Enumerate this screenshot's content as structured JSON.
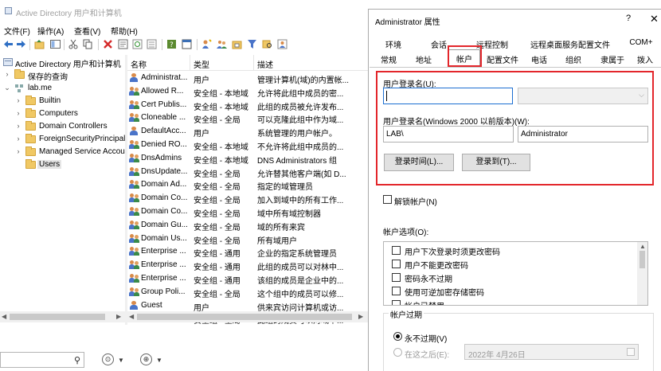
{
  "main_window": {
    "title": "Active Directory 用户和计算机"
  },
  "menu": [
    "文件(F)",
    "操作(A)",
    "查看(V)",
    "帮助(H)"
  ],
  "tree": {
    "root": "Active Directory 用户和计算机",
    "saved_queries": "保存的查询",
    "domain": "lab.me",
    "containers": [
      "Builtin",
      "Computers",
      "Domain Controllers",
      "ForeignSecurityPrincipals",
      "Managed Service Accounts",
      "Users"
    ]
  },
  "list": {
    "columns": [
      "名称",
      "类型",
      "描述"
    ],
    "rows": [
      {
        "name": "Administrat...",
        "type": "用户",
        "desc": "管理计算机(域)的内置帐...",
        "icon": "user-icon"
      },
      {
        "name": "Allowed R...",
        "type": "安全组 - 本地域",
        "desc": "允许将此组中成员的密...",
        "icon": "group-icon"
      },
      {
        "name": "Cert Publis...",
        "type": "安全组 - 本地域",
        "desc": "此组的成员被允许发布...",
        "icon": "group-icon"
      },
      {
        "name": "Cloneable ...",
        "type": "安全组 - 全局",
        "desc": "可以克隆此组中作为域...",
        "icon": "group-icon"
      },
      {
        "name": "DefaultAcc...",
        "type": "用户",
        "desc": "系统管理的用户帐户。",
        "icon": "user-icon"
      },
      {
        "name": "Denied RO...",
        "type": "安全组 - 本地域",
        "desc": "不允许将此组中成员的...",
        "icon": "group-icon"
      },
      {
        "name": "DnsAdmins",
        "type": "安全组 - 本地域",
        "desc": "DNS Administrators 组",
        "icon": "group-icon"
      },
      {
        "name": "DnsUpdate...",
        "type": "安全组 - 全局",
        "desc": "允许替其他客户端(如 D...",
        "icon": "group-icon"
      },
      {
        "name": "Domain Ad...",
        "type": "安全组 - 全局",
        "desc": "指定的域管理员",
        "icon": "group-icon"
      },
      {
        "name": "Domain Co...",
        "type": "安全组 - 全局",
        "desc": "加入到域中的所有工作...",
        "icon": "group-icon"
      },
      {
        "name": "Domain Co...",
        "type": "安全组 - 全局",
        "desc": "域中所有域控制器",
        "icon": "group-icon"
      },
      {
        "name": "Domain Gu...",
        "type": "安全组 - 全局",
        "desc": "域的所有来宾",
        "icon": "group-icon"
      },
      {
        "name": "Domain Us...",
        "type": "安全组 - 全局",
        "desc": "所有域用户",
        "icon": "group-icon"
      },
      {
        "name": "Enterprise ...",
        "type": "安全组 - 通用",
        "desc": "企业的指定系统管理员",
        "icon": "group-icon"
      },
      {
        "name": "Enterprise ...",
        "type": "安全组 - 通用",
        "desc": "此组的成员可以对林中...",
        "icon": "group-icon"
      },
      {
        "name": "Enterprise ...",
        "type": "安全组 - 通用",
        "desc": "该组的成员是企业中的...",
        "icon": "group-icon"
      },
      {
        "name": "Group Poli...",
        "type": "安全组 - 全局",
        "desc": "这个组中的成员可以修...",
        "icon": "group-icon"
      },
      {
        "name": "Guest",
        "type": "用户",
        "desc": "供来宾访问计算机或访...",
        "icon": "user-icon"
      },
      {
        "name": "Key Admins",
        "type": "安全组 - 全局",
        "desc": "此组的成员可以对域中...",
        "icon": "group-icon"
      }
    ]
  },
  "dialog": {
    "title": "Administrator 属性",
    "help_glyph": "?",
    "close_glyph": "✕",
    "tabs_row1": [
      "环境",
      "会话",
      "远程控制",
      "远程桌面服务配置文件",
      "COM+"
    ],
    "tabs_row2": [
      "常规",
      "地址",
      "帐户",
      "配置文件",
      "电话",
      "组织",
      "隶属于",
      "拨入"
    ],
    "active_tab": "帐户",
    "logon_name_label": "用户登录名(U):",
    "logon_name_value": "",
    "upn_suffix_value": "",
    "pre2000_label": "用户登录名(Windows 2000 以前版本)(W):",
    "pre2000_domain": "LAB\\",
    "pre2000_name": "Administrator",
    "logon_hours_button": "登录时间(L)...",
    "logon_to_button": "登录到(T)...",
    "unlock_label": "解锁帐户(N)",
    "options_label": "帐户选项(O):",
    "options": [
      "用户下次登录时须更改密码",
      "用户不能更改密码",
      "密码永不过期",
      "使用可逆加密存储密码",
      "帐户已禁用"
    ],
    "expire_label": "帐户过期",
    "never_label": "永不过期(V)",
    "end_of_label": "在这之后(E):",
    "end_of_date": "2022年  4月26日"
  },
  "colors": {
    "highlight_red": "#e3262b",
    "focus_blue": "#1c6fd1"
  }
}
